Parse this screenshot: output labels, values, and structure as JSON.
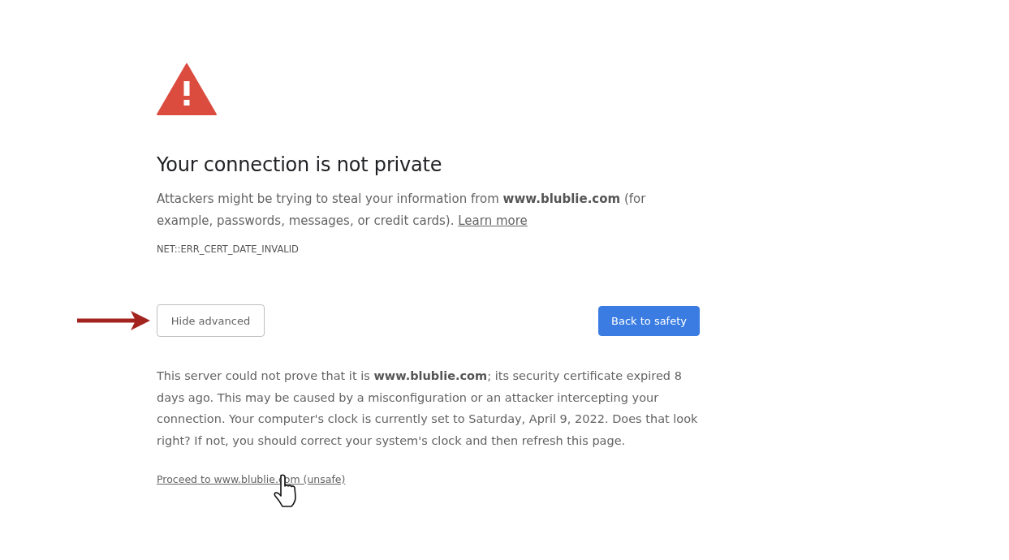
{
  "heading": "Your connection is not private",
  "intro": "Attackers might be trying to steal your information from **www.blublie.com** (for example, passwords, messages, or credit cards).",
  "learn_more_link": "Learn more",
  "error_code": "NET::ERR_CERT_DATE_INVALID",
  "buttons": [
    {
      "label": "Hide advanced",
      "kind": "secondary"
    },
    {
      "label": "Back to safety",
      "kind": "primary"
    }
  ],
  "details": "This server could not prove that it is **www.blublie.com**; its security certificate expired 8 days ago. This may be caused by a misconfiguration or an attacker intercepting your connection. Your computer's clock is currently set to Saturday, April 9, 2022. Does that look right? If not, you should correct your system's clock and then refresh this page.",
  "proceed_link": "Proceed to www.blublie.com (unsafe)"
}
